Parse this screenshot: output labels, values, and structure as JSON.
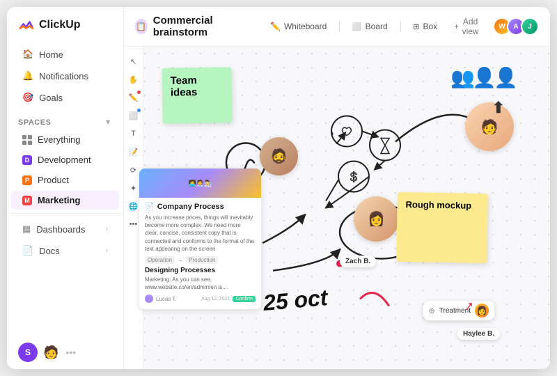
{
  "app": {
    "name": "ClickUp"
  },
  "sidebar": {
    "nav": [
      {
        "id": "home",
        "label": "Home",
        "icon": "🏠"
      },
      {
        "id": "notifications",
        "label": "Notifications",
        "icon": "🔔"
      },
      {
        "id": "goals",
        "label": "Goals",
        "icon": "🎯"
      }
    ],
    "spaces_label": "Spaces",
    "spaces": [
      {
        "id": "everything",
        "label": "Everything",
        "color": ""
      },
      {
        "id": "development",
        "label": "Development",
        "color": "#7c3aed",
        "initial": "D"
      },
      {
        "id": "product",
        "label": "Product",
        "color": "#f97316",
        "initial": "P"
      },
      {
        "id": "marketing",
        "label": "Marketing",
        "color": "#ef4444",
        "initial": "M"
      }
    ],
    "bottom": [
      {
        "id": "dashboards",
        "label": "Dashboards"
      },
      {
        "id": "docs",
        "label": "Docs"
      }
    ],
    "user": {
      "initial": "S"
    }
  },
  "topbar": {
    "title": "Commercial brainstorm",
    "views": [
      {
        "id": "whiteboard",
        "label": "Whiteboard",
        "active": true
      },
      {
        "id": "board",
        "label": "Board",
        "active": false
      },
      {
        "id": "box",
        "label": "Box",
        "active": false
      }
    ],
    "add_view_label": "Add view"
  },
  "whiteboard": {
    "sticky_green_text": "Team ideas",
    "sticky_yellow_text": "Rough mockup",
    "card_title": "Company Process",
    "card_text": "As you increase prices, things will inevitably become more complex. We need more clear, concise, consistent copy that is connected and conforms to the format of the text appearing on the screen",
    "card_section": "Designing Processes",
    "card_section_text": "Marketing: As you can see, www.website.co/en/admin/en is...",
    "badge_zach": "Zach B.",
    "badge_haylee": "Haylee B.",
    "badge_treatment": "Treatment",
    "date_text": "25 oct",
    "toolbar_tools": [
      "cursor",
      "hand",
      "pen",
      "shapes",
      "text",
      "sticky",
      "connector",
      "star",
      "globe",
      "more"
    ]
  }
}
